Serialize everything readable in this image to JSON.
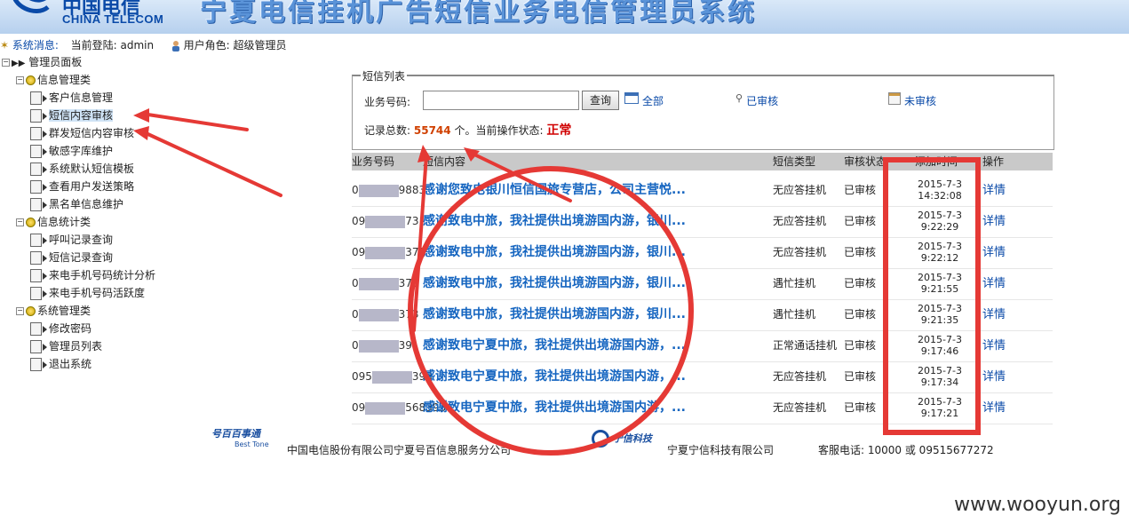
{
  "banner": {
    "logo_cn": "中国电信",
    "logo_en": "CHINA TELECOM",
    "title": "宁夏电信挂机广告短信业务电信管理员系统"
  },
  "status": {
    "sys_label": "系统消息:",
    "login_label": "当前登陆:",
    "user": "admin",
    "role_label": "用户角色:",
    "role": "超级管理员"
  },
  "tree": [
    {
      "label": "管理员面板",
      "kind": "root"
    },
    {
      "label": "信息管理类",
      "kind": "group"
    },
    {
      "label": "客户信息管理",
      "kind": "leaf"
    },
    {
      "label": "短信内容审核",
      "kind": "leaf"
    },
    {
      "label": "群发短信内容审核",
      "kind": "leaf"
    },
    {
      "label": "敏感字库维护",
      "kind": "leaf"
    },
    {
      "label": "系统默认短信模板",
      "kind": "leaf"
    },
    {
      "label": "查看用户发送策略",
      "kind": "leaf"
    },
    {
      "label": "黑名单信息维护",
      "kind": "leaf"
    },
    {
      "label": "信息统计类",
      "kind": "group"
    },
    {
      "label": "呼叫记录查询",
      "kind": "leaf"
    },
    {
      "label": "短信记录查询",
      "kind": "leaf"
    },
    {
      "label": "来电手机号码统计分析",
      "kind": "leaf"
    },
    {
      "label": "来电手机号码活跃度",
      "kind": "leaf"
    },
    {
      "label": "系统管理类",
      "kind": "group"
    },
    {
      "label": "修改密码",
      "kind": "leaf"
    },
    {
      "label": "管理员列表",
      "kind": "leaf"
    },
    {
      "label": "退出系统",
      "kind": "leaf"
    }
  ],
  "search": {
    "legend": "短信列表",
    "field_label": "业务号码:",
    "value": "",
    "query_button": "查询",
    "all_link": "全部",
    "reviewed_link": "已审核",
    "unreviewed_link": "未审核",
    "total_label": "记录总数:",
    "total_count": "55744",
    "total_suffix": "个。当前操作状态:",
    "state": "正常"
  },
  "table": {
    "headers": [
      "业务号码",
      "短信内容",
      "短信类型",
      "审核状态",
      "添加时间",
      "操作"
    ],
    "rows": [
      {
        "phone_start": "0",
        "phone_end": "9883",
        "content": "感谢您致电银川恒信国旅专营店，公司主营悦...",
        "type": "无应答挂机",
        "status": "已审核",
        "date": "2015-7-3",
        "time": "14:32:08",
        "action": "详情"
      },
      {
        "phone_start": "09",
        "phone_end": "73",
        "content": "感谢致电中旅，我社提供出境游国内游，银川...",
        "type": "无应答挂机",
        "status": "已审核",
        "date": "2015-7-3",
        "time": "9:22:29",
        "action": "详情"
      },
      {
        "phone_start": "09",
        "phone_end": "373",
        "content": "感谢致电中旅，我社提供出境游国内游，银川...",
        "type": "无应答挂机",
        "status": "已审核",
        "date": "2015-7-3",
        "time": "9:22:12",
        "action": "详情"
      },
      {
        "phone_start": "0",
        "phone_end": "373",
        "content": "感谢致电中旅，我社提供出境游国内游，银川...",
        "type": "遇忙挂机",
        "status": "已审核",
        "date": "2015-7-3",
        "time": "9:21:55",
        "action": "详情"
      },
      {
        "phone_start": "0",
        "phone_end": "373",
        "content": "感谢致电中旅，我社提供出境游国内游，银川...",
        "type": "遇忙挂机",
        "status": "已审核",
        "date": "2015-7-3",
        "time": "9:21:35",
        "action": "详情"
      },
      {
        "phone_start": "0",
        "phone_end": "39",
        "content": "感谢致电宁夏中旅，我社提供出境游国内游，...",
        "type": "正常通话挂机",
        "status": "已审核",
        "date": "2015-7-3",
        "time": "9:17:46",
        "action": "详情"
      },
      {
        "phone_start": "095",
        "phone_end": "393",
        "content": "感谢致电宁夏中旅，我社提供出境游国内游，...",
        "type": "无应答挂机",
        "status": "已审核",
        "date": "2015-7-3",
        "time": "9:17:34",
        "action": "详情"
      },
      {
        "phone_start": "09",
        "phone_end": "568393",
        "content": "感谢致电宁夏中旅，我社提供出境游国内游，...",
        "type": "无应答挂机",
        "status": "已审核",
        "date": "2015-7-3",
        "time": "9:17:21",
        "action": "详情"
      }
    ]
  },
  "footer": {
    "bt_logo_cn": "号百百事通",
    "bt_logo_en": "Best Tone",
    "company1": "中国电信股份有限公司宁夏号百信息服务分公司",
    "ningxin_logo": "宁信科技",
    "company2": "宁夏宁信科技有限公司",
    "service_label": "客服电话:",
    "service_numbers": "10000 或 09515677272"
  },
  "watermark": "www.wooyun.org",
  "colors": {
    "annotation_red": "#e53935",
    "link_blue": "#0a4aa8",
    "content_blue": "#1565c0",
    "header_gray": "#c9c9c9"
  }
}
